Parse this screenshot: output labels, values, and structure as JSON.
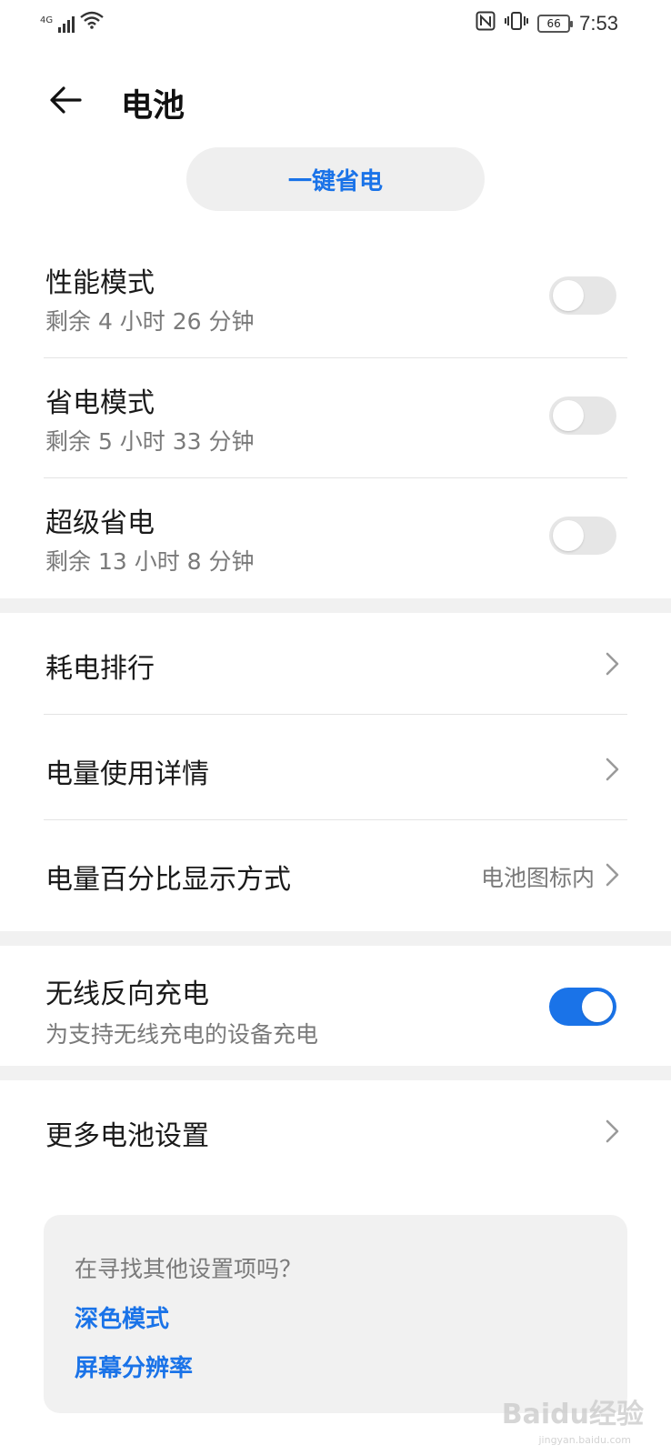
{
  "status_bar": {
    "network_type": "4G",
    "battery_level": "66",
    "time": "7:53",
    "icons": [
      "signal-icon",
      "wifi-icon",
      "nfc-icon",
      "vibrate-icon",
      "battery-icon"
    ]
  },
  "header": {
    "title": "电池",
    "back_icon": "back-arrow-icon"
  },
  "quick_save": {
    "label": "一键省电"
  },
  "modes": [
    {
      "title": "性能模式",
      "subtitle": "剩余 4 小时 26 分钟",
      "enabled": false
    },
    {
      "title": "省电模式",
      "subtitle": "剩余 5 小时 33 分钟",
      "enabled": false
    },
    {
      "title": "超级省电",
      "subtitle": "剩余 13 小时 8 分钟",
      "enabled": false
    }
  ],
  "nav_items": [
    {
      "label": "耗电排行",
      "value": ""
    },
    {
      "label": "电量使用详情",
      "value": ""
    },
    {
      "label": "电量百分比显示方式",
      "value": "电池图标内"
    }
  ],
  "wireless": {
    "title": "无线反向充电",
    "subtitle": "为支持无线充电的设备充电",
    "enabled": true
  },
  "more_settings": {
    "label": "更多电池设置"
  },
  "suggestions": {
    "question": "在寻找其他设置项吗？",
    "links": [
      "深色模式",
      "屏幕分辨率"
    ]
  },
  "watermark": {
    "text": "Baidu经验",
    "sub": "jingyan.baidu.com"
  },
  "colors": {
    "accent": "#1a73e8",
    "toggle_off": "#e6e6e6",
    "secondary_text": "#7a7a7a",
    "band": "#f1f1f1"
  }
}
